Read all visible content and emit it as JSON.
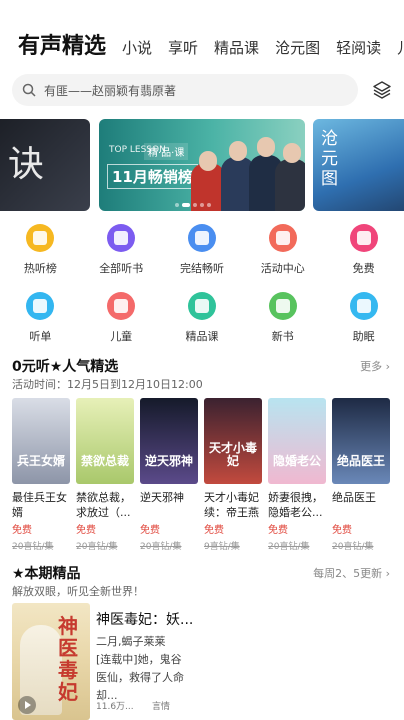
{
  "tabs": [
    "有声精选",
    "小说",
    "享听",
    "精品课",
    "沧元图",
    "轻阅读",
    "儿童"
  ],
  "search": {
    "text": "有匪——赵丽颖有翡原著"
  },
  "banner": {
    "left_title": "诀",
    "mid_tag": "TOP LESSON",
    "mid_tag2": "精·品·课",
    "mid_title": "11月畅销榜",
    "right_title": "沧元图"
  },
  "grid": [
    {
      "label": "热听榜",
      "color": "#f6b821",
      "icon": "crown-icon"
    },
    {
      "label": "全部听书",
      "color": "#7c5cf0",
      "icon": "headphones-icon"
    },
    {
      "label": "完结畅听",
      "color": "#4a8ef0",
      "icon": "book-check-icon"
    },
    {
      "label": "活动中心",
      "color": "#f26a5a",
      "icon": "tag-icon"
    },
    {
      "label": "免费",
      "color": "#f0457a",
      "icon": "free-icon"
    },
    {
      "label": "听单",
      "color": "#33b6f0",
      "icon": "cup-icon"
    },
    {
      "label": "儿童",
      "color": "#f46a6a",
      "icon": "child-face-icon"
    },
    {
      "label": "精品课",
      "color": "#2fc39a",
      "icon": "teacher-icon"
    },
    {
      "label": "新书",
      "color": "#58c35e",
      "icon": "new-book-icon"
    },
    {
      "label": "助眠",
      "color": "#35b8f0",
      "icon": "sleep-cup-icon"
    }
  ],
  "section1": {
    "title": "0元听★人气精选",
    "more": "更多",
    "subtitle": "活动时间：12月5日到12月10日12:00",
    "books": [
      {
        "title": "最佳兵王女婿",
        "free": "免费",
        "price": "20喜钻/集",
        "cover_text": "兵王女婿",
        "c1": "#d9dde6",
        "c2": "#8d95a8"
      },
      {
        "title": "禁欲总裁，求放过（...",
        "free": "免费",
        "price": "20喜钻/集",
        "cover_text": "禁欲总裁",
        "c1": "#e7f0b8",
        "c2": "#a9c86b"
      },
      {
        "title": "逆天邪神",
        "free": "免费",
        "price": "20喜钻/集",
        "cover_text": "逆天邪神",
        "c1": "#151a2a",
        "c2": "#5b4a8a"
      },
      {
        "title": "天才小毒妃续：帝王燕",
        "free": "免费",
        "price": "9喜钻/集",
        "cover_text": "天才小毒妃",
        "c1": "#3b2230",
        "c2": "#c24a3e"
      },
      {
        "title": "娇妻很拽，隐婚老公...",
        "free": "免费",
        "price": "20喜钻/集",
        "cover_text": "隐婚老公",
        "c1": "#b8e4f0",
        "c2": "#f0b8d0"
      },
      {
        "title": "绝品医王",
        "free": "免费",
        "price": "20喜钻/集",
        "cover_text": "绝品医王",
        "c1": "#1e2a44",
        "c2": "#6a88b8"
      }
    ]
  },
  "section2": {
    "title": "★本期精品",
    "more": "每周2、5更新",
    "subtitle": "解放双眼，听见全新世界！",
    "feature": {
      "title": "神医毒妃：妖...",
      "author": "二月,蝎子莱莱",
      "desc": "[连载中]她，鬼谷医仙，救得了人命却...",
      "plays": "11.6万...",
      "category": "言情",
      "cover_text": "神医毒妃"
    }
  }
}
